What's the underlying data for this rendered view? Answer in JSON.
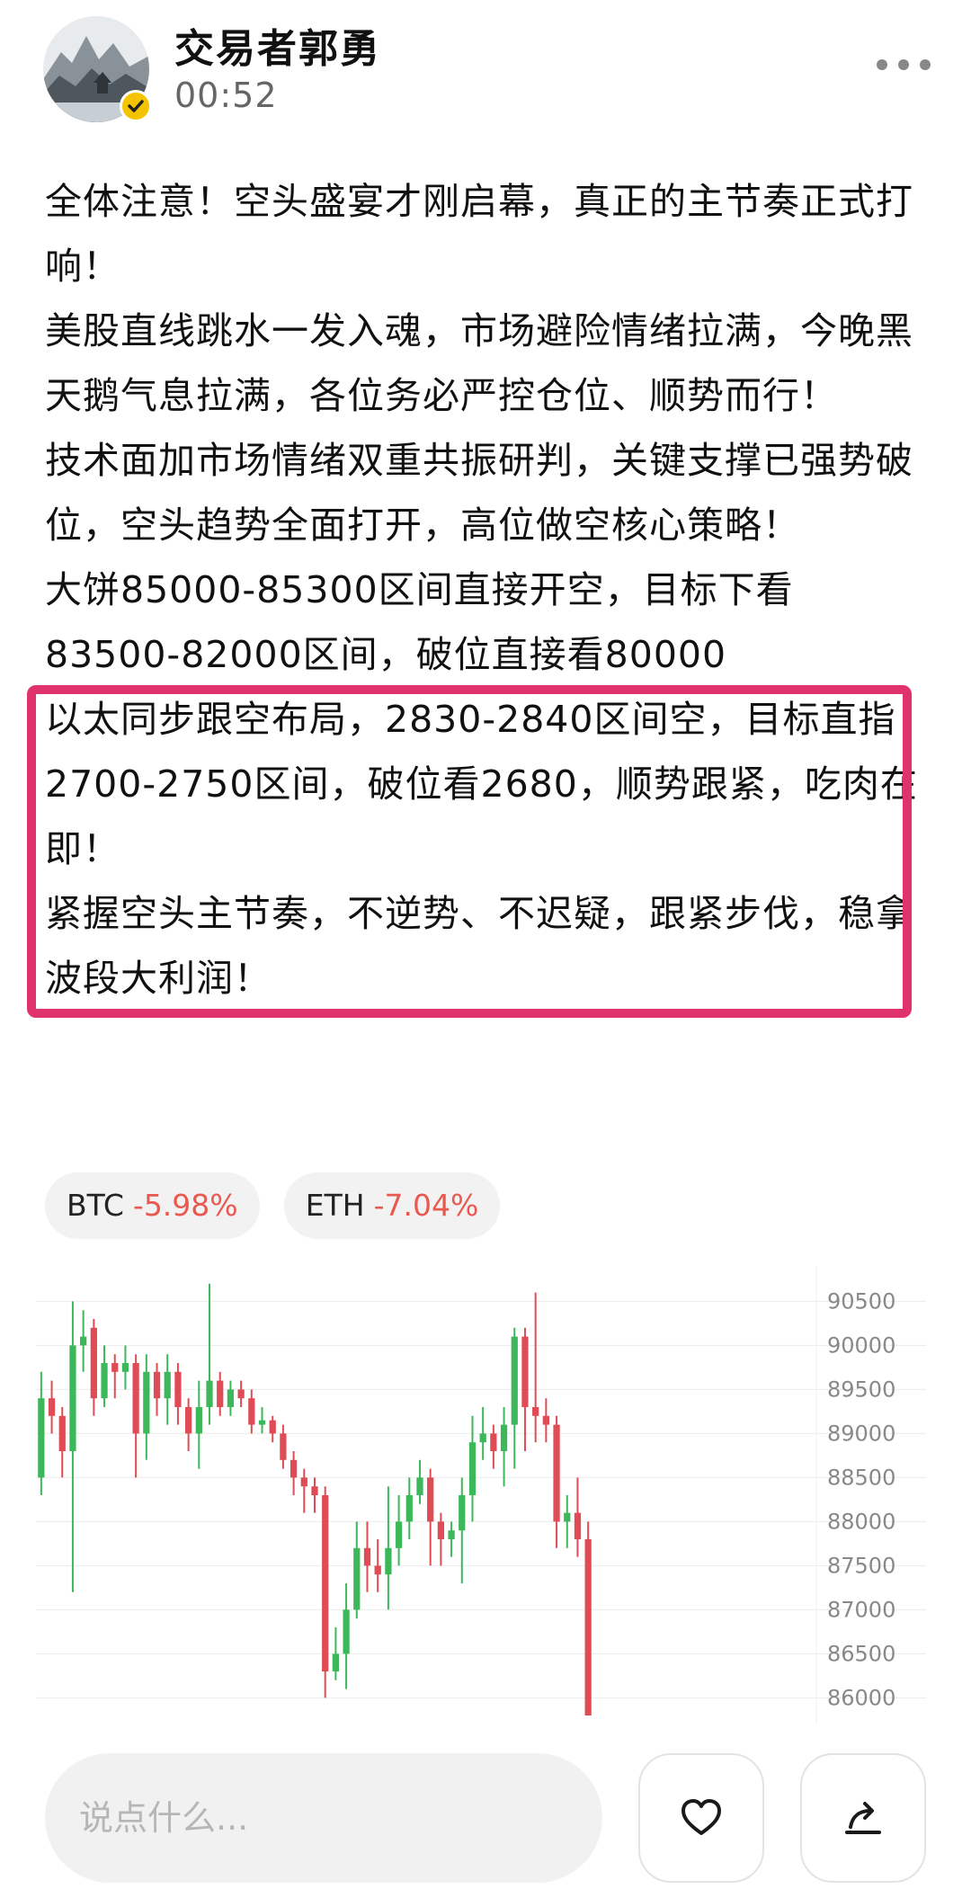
{
  "author": {
    "name": "交易者郭勇",
    "time": "00:52",
    "verified": true
  },
  "post": {
    "paragraphs": [
      "全体注意！空头盛宴才刚启幕，真正的主节奏正式打响！",
      "美股直线跳水一发入魂，市场避险情绪拉满，今晚黑天鹅气息拉满，各位务必严控仓位、顺势而行！",
      "技术面加市场情绪双重共振研判，关键支撑已强势破位，空头趋势全面打开，高位做空核心策略！",
      "大饼85000-85300区间直接开空，目标下看83500-82000区间，破位直接看80000",
      "以太同步跟空布局，2830-2840区间空，目标直指2700-2750区间，破位看2680，顺势跟紧，吃肉在即！",
      "紧握空头主节奏，不逆势、不迟疑，跟紧步伐，稳拿波段大利润！"
    ]
  },
  "tickers": [
    {
      "symbol": "BTC",
      "change": "-5.98%"
    },
    {
      "symbol": "ETH",
      "change-": "",
      "change": "-7.04%"
    }
  ],
  "chart_data": {
    "type": "candlestick",
    "title": "",
    "ylim": [
      85800,
      90800
    ],
    "y_ticks": [
      "90500",
      "90000",
      "89500",
      "89000",
      "88500",
      "88000",
      "87500",
      "87000",
      "86500",
      "86000"
    ],
    "colors": {
      "up": "#3cb85a",
      "down": "#e04c55",
      "grid": "#ececec"
    },
    "candles": [
      {
        "o": 88500,
        "c": 89400,
        "h": 89700,
        "l": 88300
      },
      {
        "o": 89400,
        "c": 89200,
        "h": 89600,
        "l": 89000
      },
      {
        "o": 89200,
        "c": 88800,
        "h": 89300,
        "l": 88500
      },
      {
        "o": 88800,
        "c": 90000,
        "h": 90500,
        "l": 87200
      },
      {
        "o": 90000,
        "c": 90100,
        "h": 90400,
        "l": 89700
      },
      {
        "o": 90200,
        "c": 89400,
        "h": 90300,
        "l": 89200
      },
      {
        "o": 89400,
        "c": 89800,
        "h": 90000,
        "l": 89300
      },
      {
        "o": 89800,
        "c": 89700,
        "h": 89900,
        "l": 89400
      },
      {
        "o": 89700,
        "c": 89800,
        "h": 90000,
        "l": 89500
      },
      {
        "o": 89800,
        "c": 89000,
        "h": 89900,
        "l": 88500
      },
      {
        "o": 89000,
        "c": 89700,
        "h": 89900,
        "l": 88700
      },
      {
        "o": 89700,
        "c": 89400,
        "h": 89800,
        "l": 89200
      },
      {
        "o": 89400,
        "c": 89700,
        "h": 89900,
        "l": 89100
      },
      {
        "o": 89700,
        "c": 89300,
        "h": 89800,
        "l": 89100
      },
      {
        "o": 89300,
        "c": 89000,
        "h": 89400,
        "l": 88800
      },
      {
        "o": 89000,
        "c": 89300,
        "h": 89600,
        "l": 88600
      },
      {
        "o": 89300,
        "c": 89600,
        "h": 90700,
        "l": 89100
      },
      {
        "o": 89600,
        "c": 89300,
        "h": 89700,
        "l": 89200
      },
      {
        "o": 89300,
        "c": 89500,
        "h": 89600,
        "l": 89200
      },
      {
        "o": 89500,
        "c": 89400,
        "h": 89600,
        "l": 89300
      },
      {
        "o": 89400,
        "c": 89100,
        "h": 89500,
        "l": 89000
      },
      {
        "o": 89100,
        "c": 89150,
        "h": 89300,
        "l": 89000
      },
      {
        "o": 89150,
        "c": 89000,
        "h": 89200,
        "l": 88900
      },
      {
        "o": 89000,
        "c": 88700,
        "h": 89100,
        "l": 88600
      },
      {
        "o": 88700,
        "c": 88500,
        "h": 88800,
        "l": 88300
      },
      {
        "o": 88500,
        "c": 88400,
        "h": 88600,
        "l": 88100
      },
      {
        "o": 88400,
        "c": 88300,
        "h": 88500,
        "l": 88100
      },
      {
        "o": 88300,
        "c": 86300,
        "h": 88400,
        "l": 86000
      },
      {
        "o": 86300,
        "c": 86500,
        "h": 86800,
        "l": 86200
      },
      {
        "o": 86500,
        "c": 87000,
        "h": 87300,
        "l": 86100
      },
      {
        "o": 87000,
        "c": 87700,
        "h": 88000,
        "l": 86900
      },
      {
        "o": 87700,
        "c": 87500,
        "h": 88000,
        "l": 87200
      },
      {
        "o": 87500,
        "c": 87400,
        "h": 87800,
        "l": 87200
      },
      {
        "o": 87400,
        "c": 87700,
        "h": 88400,
        "l": 87000
      },
      {
        "o": 87700,
        "c": 88000,
        "h": 88300,
        "l": 87500
      },
      {
        "o": 88000,
        "c": 88300,
        "h": 88500,
        "l": 87800
      },
      {
        "o": 88300,
        "c": 88500,
        "h": 88700,
        "l": 88200
      },
      {
        "o": 88500,
        "c": 88000,
        "h": 88600,
        "l": 87500
      },
      {
        "o": 88000,
        "c": 87800,
        "h": 88100,
        "l": 87500
      },
      {
        "o": 87800,
        "c": 87900,
        "h": 88000,
        "l": 87600
      },
      {
        "o": 87900,
        "c": 88300,
        "h": 88500,
        "l": 87300
      },
      {
        "o": 88300,
        "c": 88900,
        "h": 89200,
        "l": 88000
      },
      {
        "o": 88900,
        "c": 89000,
        "h": 89300,
        "l": 88700
      },
      {
        "o": 89000,
        "c": 88800,
        "h": 89100,
        "l": 88600
      },
      {
        "o": 88800,
        "c": 89100,
        "h": 89300,
        "l": 88400
      },
      {
        "o": 89100,
        "c": 90100,
        "h": 90200,
        "l": 88600
      },
      {
        "o": 90100,
        "c": 89300,
        "h": 90200,
        "l": 88800
      },
      {
        "o": 89300,
        "c": 89200,
        "h": 90600,
        "l": 88900
      },
      {
        "o": 89200,
        "c": 89100,
        "h": 89400,
        "l": 88900
      },
      {
        "o": 89100,
        "c": 88000,
        "h": 89200,
        "l": 87700
      },
      {
        "o": 88000,
        "c": 88100,
        "h": 88300,
        "l": 87700
      },
      {
        "o": 88100,
        "c": 87800,
        "h": 88500,
        "l": 87600
      },
      {
        "o": 87800,
        "c": 85800,
        "h": 88000,
        "l": 85800
      }
    ]
  },
  "comment": {
    "placeholder": "说点什么..."
  },
  "actions": {
    "like_icon": "heart-icon",
    "share_icon": "share-icon"
  }
}
